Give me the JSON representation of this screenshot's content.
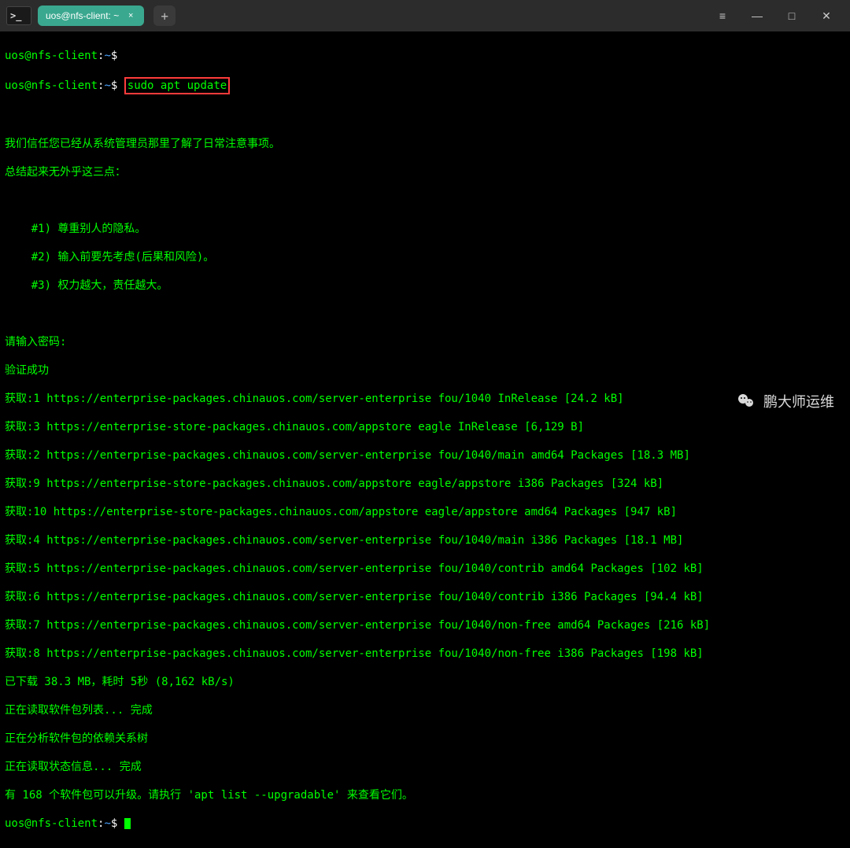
{
  "titlebar": {
    "app_icon_text": ">_",
    "tab_label": "uos@nfs-client: ~",
    "tab_close": "×",
    "new_tab": "+",
    "menu": "≡",
    "minimize": "—",
    "maximize": "□",
    "close": "✕"
  },
  "prompt": {
    "user_host": "uos@nfs-client",
    "colon": ":",
    "path": "~",
    "dollar": "$"
  },
  "command": "sudo apt update",
  "output": {
    "trust_line": "我们信任您已经从系统管理员那里了解了日常注意事项。",
    "summary_line": "总结起来无外乎这三点：",
    "rule1": "    #1) 尊重别人的隐私。",
    "rule2": "    #2) 输入前要先考虑(后果和风险)。",
    "rule3": "    #3) 权力越大，责任越大。",
    "pw_prompt": "请输入密码:",
    "verify_ok": "验证成功",
    "hit1": "获取:1 https://enterprise-packages.chinauos.com/server-enterprise fou/1040 InRelease [24.2 kB]",
    "hit3": "获取:3 https://enterprise-store-packages.chinauos.com/appstore eagle InRelease [6,129 B]",
    "hit2": "获取:2 https://enterprise-packages.chinauos.com/server-enterprise fou/1040/main amd64 Packages [18.3 MB]",
    "hit9": "获取:9 https://enterprise-store-packages.chinauos.com/appstore eagle/appstore i386 Packages [324 kB]",
    "hit10": "获取:10 https://enterprise-store-packages.chinauos.com/appstore eagle/appstore amd64 Packages [947 kB]",
    "hit4": "获取:4 https://enterprise-packages.chinauos.com/server-enterprise fou/1040/main i386 Packages [18.1 MB]",
    "hit5": "获取:5 https://enterprise-packages.chinauos.com/server-enterprise fou/1040/contrib amd64 Packages [102 kB]",
    "hit6": "获取:6 https://enterprise-packages.chinauos.com/server-enterprise fou/1040/contrib i386 Packages [94.4 kB]",
    "hit7": "获取:7 https://enterprise-packages.chinauos.com/server-enterprise fou/1040/non-free amd64 Packages [216 kB]",
    "hit8": "获取:8 https://enterprise-packages.chinauos.com/server-enterprise fou/1040/non-free i386 Packages [198 kB]",
    "downloaded": "已下载 38.3 MB，耗时 5秒 (8,162 kB/s)",
    "reading_pkg": "正在读取软件包列表... 完成",
    "building_tree": "正在分析软件包的依赖关系树",
    "reading_state": "正在读取状态信息... 完成",
    "upgradable": "有 168 个软件包可以升级。请执行 'apt list --upgradable' 来查看它们。"
  },
  "watermark": {
    "text": "鹏大师运维"
  }
}
